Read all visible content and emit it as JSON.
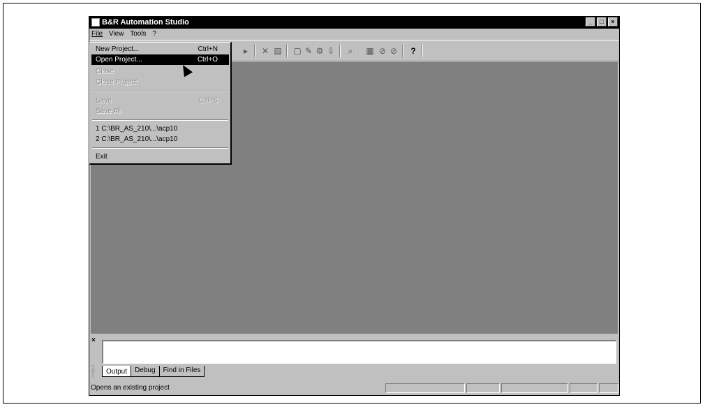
{
  "window": {
    "title": "B&R Automation Studio",
    "controls": [
      "_",
      "□",
      "×"
    ]
  },
  "menubar": {
    "items": [
      "File",
      "View",
      "Tools",
      "?"
    ]
  },
  "file_menu": {
    "items": [
      {
        "label": "New Project...",
        "shortcut": "Ctrl+N",
        "state": "enabled"
      },
      {
        "label": "Open Project...",
        "shortcut": "Ctrl+O",
        "state": "selected"
      },
      {
        "label": "Close",
        "shortcut": "",
        "state": "disabled"
      },
      {
        "label": "Close Project",
        "shortcut": "",
        "state": "disabled"
      },
      {
        "label": "Save",
        "shortcut": "Ctrl+S",
        "state": "disabled"
      },
      {
        "label": "Save All",
        "shortcut": "",
        "state": "disabled"
      },
      {
        "label": "1 C:\\BR_AS_210\\...\\acp10",
        "shortcut": "",
        "state": "enabled"
      },
      {
        "label": "2 C:\\BR_AS_210\\...\\acp10",
        "shortcut": "",
        "state": "enabled"
      },
      {
        "label": "Exit",
        "shortcut": "",
        "state": "enabled"
      }
    ]
  },
  "output": {
    "close_label": "×",
    "side_label": "Output",
    "tabs": [
      "Output",
      "Debug",
      "Find in Files"
    ]
  },
  "statusbar": {
    "text": "Opens an existing project"
  }
}
